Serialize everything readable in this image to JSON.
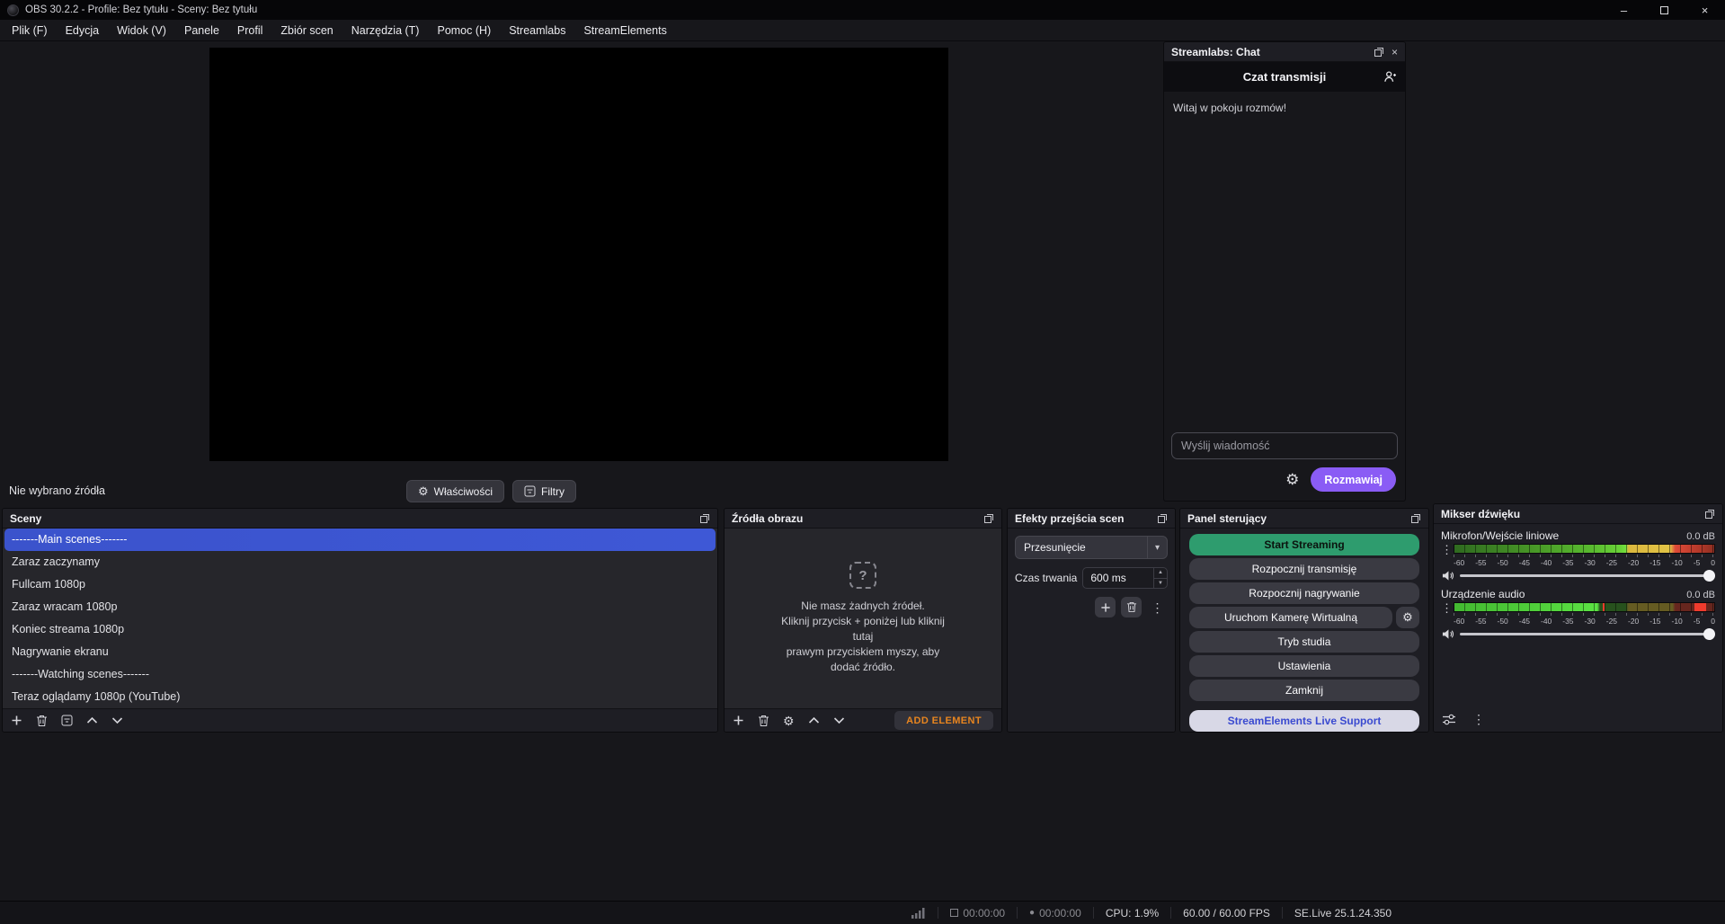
{
  "titlebar": {
    "title": "OBS 30.2.2 - Profile: Bez tytułu - Sceny: Bez tytułu"
  },
  "menubar": {
    "items": [
      "Plik (F)",
      "Edycja",
      "Widok (V)",
      "Panele",
      "Profil",
      "Zbiór scen",
      "Narzędzia (T)",
      "Pomoc (H)",
      "Streamlabs",
      "StreamElements"
    ]
  },
  "preview_toolbar": {
    "status_text": "Nie wybrano źródła",
    "properties_button": "Właściwości",
    "filters_button": "Filtry"
  },
  "chat": {
    "dock_title": "Streamlabs: Chat",
    "room_header": "Czat transmisji",
    "welcome_message": "Witaj w pokoju rozmów!",
    "input_placeholder": "Wyślij wiadomość",
    "send_button": "Rozmawiaj"
  },
  "scenes_dock": {
    "title": "Sceny",
    "items": [
      {
        "label": "-------Main scenes-------",
        "selected": true
      },
      {
        "label": "Zaraz zaczynamy",
        "selected": false
      },
      {
        "label": "Fullcam 1080p",
        "selected": false
      },
      {
        "label": "Zaraz wracam 1080p",
        "selected": false
      },
      {
        "label": "Koniec streama 1080p",
        "selected": false
      },
      {
        "label": "Nagrywanie ekranu",
        "selected": false
      },
      {
        "label": "-------Watching scenes-------",
        "selected": false
      },
      {
        "label": "Teraz oglądamy 1080p (YouTube)",
        "selected": false
      }
    ]
  },
  "sources_dock": {
    "title": "Źródła obrazu",
    "empty_lines": [
      "Nie masz żadnych źródeł.",
      "Kliknij przycisk + poniżej lub kliknij",
      "tutaj",
      "prawym przyciskiem myszy, aby",
      "dodać źródło."
    ],
    "add_element_button": "ADD ELEMENT"
  },
  "transitions_dock": {
    "title": "Efekty przejścia scen",
    "transition_value": "Przesunięcie",
    "duration_label": "Czas trwania",
    "duration_value": "600 ms"
  },
  "controls_dock": {
    "title": "Panel sterujący",
    "buttons": {
      "start_streaming": "Start Streaming",
      "start_broadcast": "Rozpocznij transmisję",
      "start_recording": "Rozpocznij nagrywanie",
      "virtual_camera": "Uruchom Kamerę Wirtualną",
      "studio_mode": "Tryb studia",
      "settings": "Ustawienia",
      "close": "Zamknij",
      "se_support": "StreamElements Live Support"
    }
  },
  "mixer_dock": {
    "title": "Mikser dźwięku",
    "channels": [
      {
        "name": "Mikrofon/Wejście liniowe",
        "value": "0.0 dB"
      },
      {
        "name": "Urządzenie audio",
        "value": "0.0 dB"
      }
    ],
    "scale_labels": [
      "-60",
      "-55",
      "-50",
      "-45",
      "-40",
      "-35",
      "-30",
      "-25",
      "-20",
      "-15",
      "-10",
      "-5",
      "0"
    ]
  },
  "statusbar": {
    "stream_time": "00:00:00",
    "rec_time": "00:00:00",
    "cpu": "CPU: 1.9%",
    "fps": "60.00 / 60.00 FPS",
    "version": "SE.Live 25.1.24.350"
  },
  "icons": {
    "minimize": "–",
    "close": "×",
    "gear": "⚙",
    "kebab": "⋮",
    "dropdown_arrow": "▾",
    "spin_up": "▲",
    "spin_down": "▼",
    "record_dot": "●",
    "question_mark": "?"
  },
  "colors": {
    "selection_blue": "#3d56cd",
    "start_streaming_green": "#2e9c6e",
    "chat_send_purple": "#8a5cf5",
    "add_element_orange": "#e8851f",
    "se_support_blue": "#3a4ad0"
  }
}
